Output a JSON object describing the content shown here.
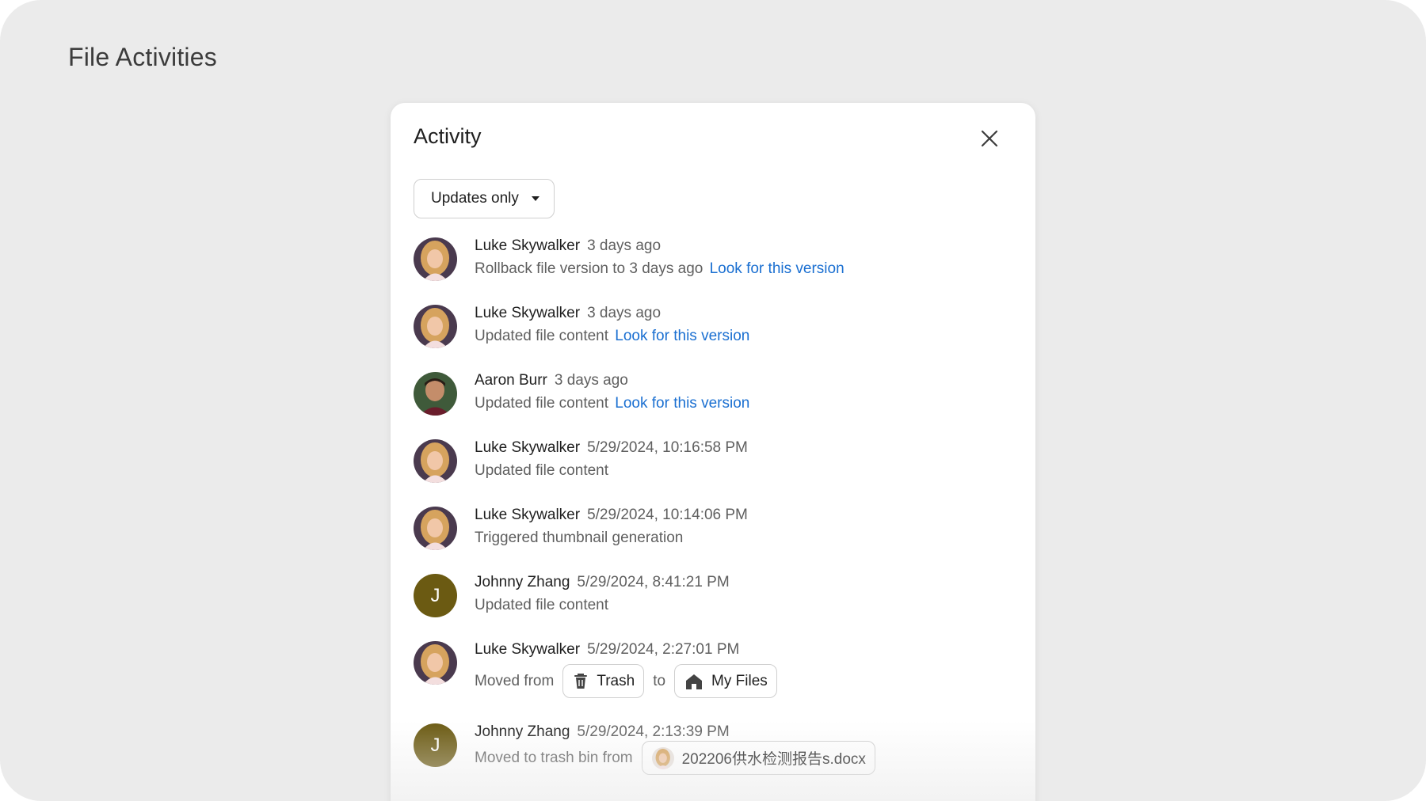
{
  "page": {
    "title": "File Activities"
  },
  "panel": {
    "title": "Activity",
    "filter_label": "Updates only",
    "close_icon": "close-icon"
  },
  "activities": [
    {
      "name": "Luke Skywalker",
      "time": "3 days ago",
      "desc": "Rollback file version to 3 days ago",
      "link": "Look for this version",
      "avatar": "luke"
    },
    {
      "name": "Luke Skywalker",
      "time": "3 days ago",
      "desc": "Updated file content",
      "link": "Look for this version",
      "avatar": "luke"
    },
    {
      "name": "Aaron Burr",
      "time": "3 days ago",
      "desc": "Updated file content",
      "link": "Look for this version",
      "avatar": "aaron"
    },
    {
      "name": "Luke Skywalker",
      "time": "5/29/2024, 10:16:58 PM",
      "desc": "Updated file content",
      "avatar": "luke"
    },
    {
      "name": "Luke Skywalker",
      "time": "5/29/2024, 10:14:06 PM",
      "desc": "Triggered thumbnail generation",
      "avatar": "luke"
    },
    {
      "name": "Johnny Zhang",
      "time": "5/29/2024, 8:41:21 PM",
      "desc": "Updated file content",
      "avatar": "J"
    },
    {
      "name": "Luke Skywalker",
      "time": "5/29/2024, 2:27:01 PM",
      "desc": "Moved from",
      "from_chip": "Trash",
      "connector": "to",
      "to_chip": "My Files",
      "avatar": "luke"
    },
    {
      "name": "Johnny Zhang",
      "time": "5/29/2024, 2:13:39 PM",
      "desc": "Moved to trash bin from",
      "file_chip": "202206供水检测报告s.docx",
      "avatar": "J"
    }
  ],
  "colors": {
    "background": "#ebebeb",
    "panel": "#ffffff",
    "link": "#1a6fd1",
    "letter_avatar": "#6b5a12"
  }
}
